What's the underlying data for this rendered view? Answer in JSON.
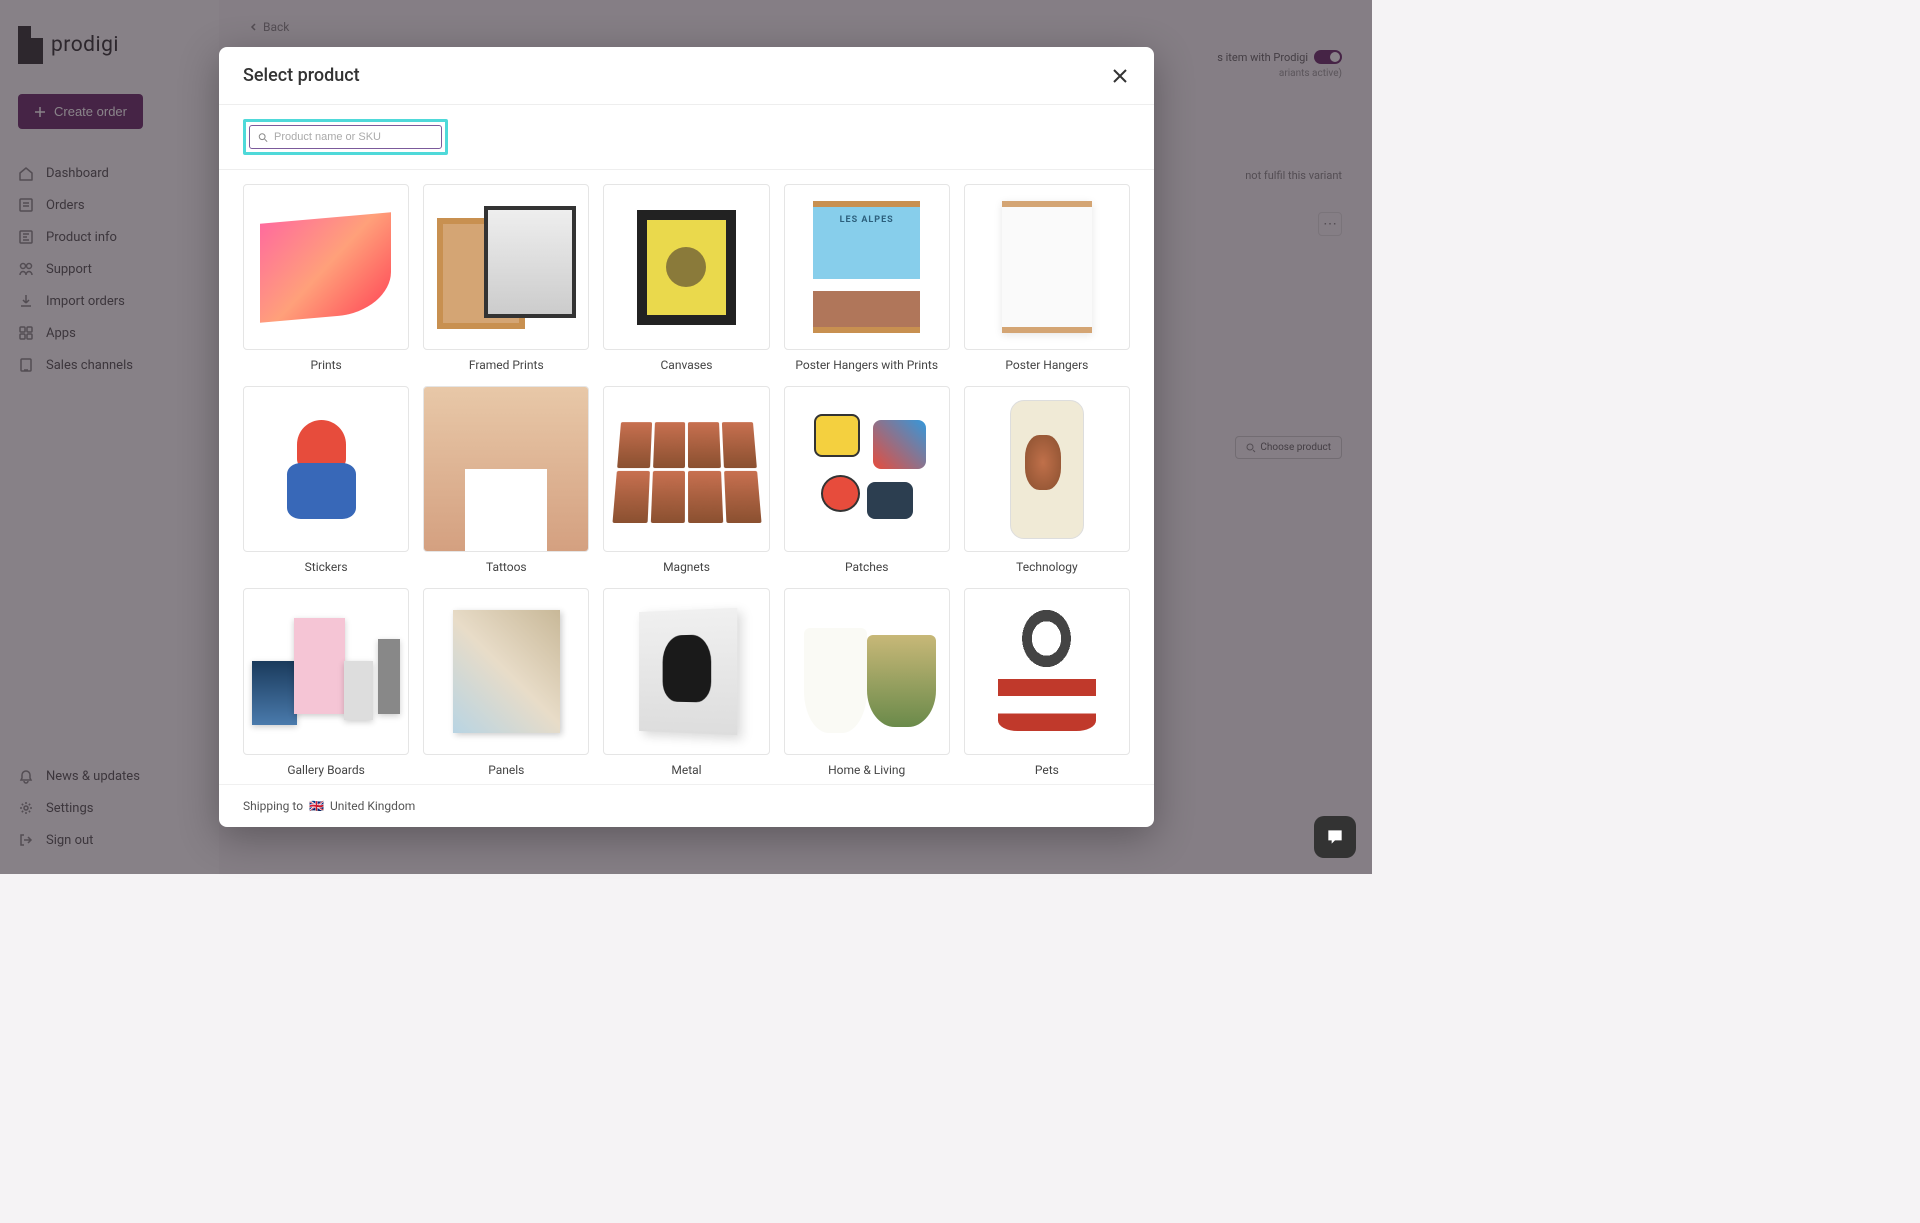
{
  "brand": "prodigi",
  "sidebar": {
    "create_label": "Create order",
    "items": [
      {
        "label": "Dashboard",
        "name": "sidebar-item-dashboard"
      },
      {
        "label": "Orders",
        "name": "sidebar-item-orders"
      },
      {
        "label": "Product info",
        "name": "sidebar-item-product-info"
      },
      {
        "label": "Support",
        "name": "sidebar-item-support"
      },
      {
        "label": "Import orders",
        "name": "sidebar-item-import-orders"
      },
      {
        "label": "Apps",
        "name": "sidebar-item-apps"
      },
      {
        "label": "Sales channels",
        "name": "sidebar-item-sales-channels"
      }
    ],
    "bottom": [
      {
        "label": "News & updates",
        "name": "sidebar-item-news"
      },
      {
        "label": "Settings",
        "name": "sidebar-item-settings"
      },
      {
        "label": "Sign out",
        "name": "sidebar-item-signout"
      }
    ]
  },
  "bg": {
    "back": "Back",
    "toggle_label": "s item with Prodigi",
    "variants": "ariants active)",
    "fulfil": "not fulfil this variant",
    "choose": "Choose product"
  },
  "modal": {
    "title": "Select product",
    "search_placeholder": "Product name or SKU",
    "categories": [
      {
        "label": "Prints",
        "name": "category-prints"
      },
      {
        "label": "Framed Prints",
        "name": "category-framed-prints"
      },
      {
        "label": "Canvases",
        "name": "category-canvases"
      },
      {
        "label": "Poster Hangers with Prints",
        "name": "category-poster-hangers-prints"
      },
      {
        "label": "Poster Hangers",
        "name": "category-poster-hangers"
      },
      {
        "label": "Stickers",
        "name": "category-stickers"
      },
      {
        "label": "Tattoos",
        "name": "category-tattoos"
      },
      {
        "label": "Magnets",
        "name": "category-magnets"
      },
      {
        "label": "Patches",
        "name": "category-patches"
      },
      {
        "label": "Technology",
        "name": "category-technology"
      },
      {
        "label": "Gallery Boards",
        "name": "category-gallery-boards"
      },
      {
        "label": "Panels",
        "name": "category-panels"
      },
      {
        "label": "Metal",
        "name": "category-metal"
      },
      {
        "label": "Home & Living",
        "name": "category-home-living"
      },
      {
        "label": "Pets",
        "name": "category-pets"
      }
    ],
    "footer_prefix": "Shipping to",
    "footer_country": "United Kingdom",
    "footer_flag": "🇬🇧"
  }
}
